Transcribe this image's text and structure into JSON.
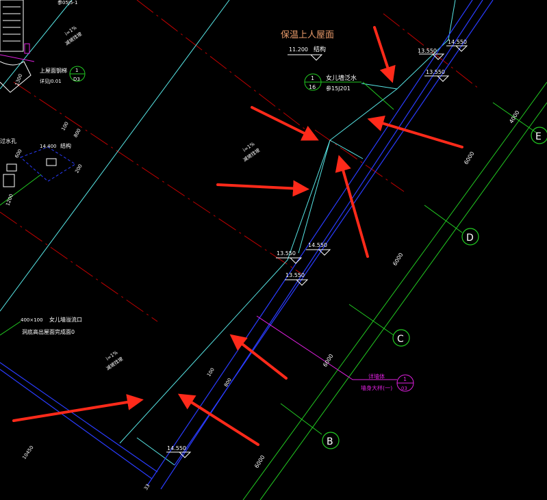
{
  "colors": {
    "background": "#000000",
    "red_line": "#c00000",
    "cyan": "#58e8e8",
    "blue": "#2a3cff",
    "green": "#22cc22",
    "white": "#ffffff",
    "magenta": "#e020e0",
    "orange": "#e89a6a",
    "arrow_red": "#ff2a1a"
  },
  "title": {
    "name": "保温上人屋面",
    "elevation": "11.200",
    "sub": "结构"
  },
  "parapet_ref": {
    "number": "1",
    "sheet": "16",
    "text": "女儿墙泛水",
    "ref": "参15J201"
  },
  "elevations": {
    "top_a": "13.550",
    "top_b": "14.550",
    "top_c": "13.550",
    "mid_a": "13.550",
    "mid_b": "14.550",
    "mid_c": "13.550",
    "bottom": "14.550"
  },
  "slopes": {
    "topleft": "i=1%",
    "topleft_text": "减坡找坡",
    "center": "i=1%",
    "center_text": "减坡找坡",
    "lower": "i=1%",
    "lower_text": "减坡找坡"
  },
  "left_notes": {
    "roof_ladder": "上屋面钢梯",
    "ladder_ref": "详见J0.01",
    "ladder_circle_top": "1",
    "ladder_circle_bottom": "D3",
    "hole_label": "过水孔",
    "hole_elev": "14.400",
    "hole_struct": "结构",
    "drain_size": "400×100",
    "drain_name": "女儿墙溢流口",
    "drain_note": "洞底高出屋面完成面0",
    "top_ref": "参05J5-1",
    "dim_1300": "1300",
    "dim_1200": "1200",
    "dim_600": "600",
    "dim_100": "100",
    "dim_800": "800",
    "dim_200": "200",
    "dim_10450": "10450"
  },
  "dims": {
    "right_upper": "4000",
    "right_mid1": "6000",
    "right_mid2": "6000",
    "right_lower1": "6000",
    "right_lower2": "6000",
    "wall_100": "100",
    "wall_800": "800",
    "bottom_33": "33"
  },
  "axes": {
    "e": "E",
    "d": "D",
    "c": "C",
    "b": "B"
  },
  "wall_detail": {
    "line1": "详墙体",
    "line2": "墙身大样(一)",
    "circle_top": "1",
    "circle_bottom": "03"
  }
}
